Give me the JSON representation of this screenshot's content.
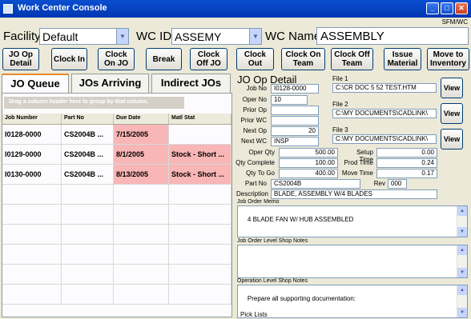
{
  "window": {
    "title": "Work Center Console",
    "badge": "SFM/WC"
  },
  "header": {
    "facility_label": "Facility",
    "facility_value": "Default",
    "wcid_label": "WC ID",
    "wcid_value": "ASSEMY",
    "wcname_label": "WC Name",
    "wcname_value": "ASSEMBLY"
  },
  "toolbar": [
    "JO Op Detail",
    "Clock In",
    "Clock On JO",
    "Break",
    "Clock Off JO",
    "Clock Out",
    "Clock On Team",
    "Clock Off Team",
    "Issue Material",
    "Move to Inventory"
  ],
  "tabs": [
    "JO Queue",
    "JOs Arriving",
    "Indirect JOs"
  ],
  "grid": {
    "group_hint": "Drag a column header here to group by that column.",
    "columns": [
      "Job Number",
      "Part No",
      "Due Date",
      "Matl Stat"
    ],
    "rows": [
      {
        "job": "I0128-0000",
        "part": "CS2004B  ...",
        "due": "7/15/2005",
        "stat": ""
      },
      {
        "job": "I0129-0000",
        "part": "CS2004B  ...",
        "due": "8/1/2005",
        "stat": "Stock - Short  ..."
      },
      {
        "job": "I0130-0000",
        "part": "CS2004B  ...",
        "due": "8/13/2005",
        "stat": "Stock - Short  ..."
      }
    ]
  },
  "detail": {
    "title": "JO Op Detail",
    "job_no_label": "Job No",
    "job_no": "I0128-0000",
    "oper_no_label": "Oper No",
    "oper_no": "10",
    "prior_op_label": "Prior Op",
    "prior_op": "",
    "prior_wc_label": "Prior WC",
    "prior_wc": "",
    "next_op_label": "Next Op",
    "next_op": "20",
    "next_wc_label": "Next WC",
    "next_wc": "INSP",
    "file1_label": "File 1",
    "file1": "C:\\CR DOC 5 52 TEST.HTM",
    "file2_label": "File 2",
    "file2": "C:\\MY DOCUMENTS\\CADLINK\\",
    "file3_label": "File 3",
    "file3": "C:\\MY DOCUMENTS\\CADLINK\\",
    "view_label": "View",
    "oper_qty_label": "Oper Qty",
    "oper_qty": "500.00",
    "qty_complete_label": "Qty Complete",
    "qty_complete": "100.00",
    "qty_to_go_label": "Qty To Go",
    "qty_to_go": "400.00",
    "setup_time_label": "Setup Time",
    "setup_time": "0.00",
    "prod_time_label": "Prod Time",
    "prod_time": "0.24",
    "move_time_label": "Move Time",
    "move_time": "0.17",
    "part_no_label": "Part No",
    "part_no": "CS2004B",
    "rev_label": "Rev",
    "rev": "000",
    "description_label": "Description",
    "description": "BLADE, ASSEMBLY W/4 BLADES",
    "memo_label": "Job Order Memo",
    "memo": "4 BLADE FAN W/ HUB ASSEMBLED",
    "jo_notes_label": "Job Order Level Shop Notes",
    "jo_notes": "",
    "op_notes_label": "Operation Level Shop Notes",
    "op_notes": "Prepare all supporting documentation:\n\nPick Lists ______\nShop Traveler______"
  }
}
